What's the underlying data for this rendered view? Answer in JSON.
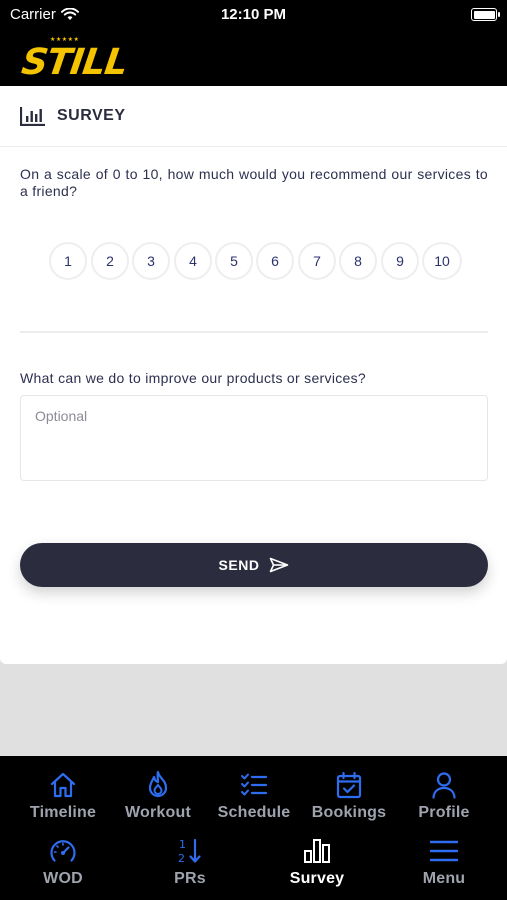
{
  "status_bar": {
    "carrier": "Carrier",
    "time": "12:10 PM"
  },
  "brand": {
    "logo_text": "STILL",
    "stars": "★★★★★",
    "accent_color": "#f5c400"
  },
  "survey": {
    "title": "SURVEY",
    "question": "On a scale of 0 to 10, how much would you recommend our services to a friend?",
    "scale": [
      "1",
      "2",
      "3",
      "4",
      "5",
      "6",
      "7",
      "8",
      "9",
      "10"
    ],
    "improve_label": "What can we do to improve our products or services?",
    "improve_placeholder": "Optional",
    "improve_value": "",
    "send_label": "SEND"
  },
  "tabbar": {
    "row1": [
      {
        "label": "Timeline",
        "icon": "home-icon"
      },
      {
        "label": "Workout",
        "icon": "flame-icon"
      },
      {
        "label": "Schedule",
        "icon": "checklist-icon"
      },
      {
        "label": "Bookings",
        "icon": "calendar-check-icon"
      },
      {
        "label": "Profile",
        "icon": "person-icon"
      }
    ],
    "row2": [
      {
        "label": "WOD",
        "icon": "gauge-icon"
      },
      {
        "label": "PRs",
        "icon": "sort-numbers-icon"
      },
      {
        "label": "Survey",
        "icon": "bar-chart-icon",
        "active": true
      },
      {
        "label": "Menu",
        "icon": "hamburger-icon"
      }
    ],
    "icon_color": "#2f6df0",
    "active_color": "#ffffff"
  }
}
